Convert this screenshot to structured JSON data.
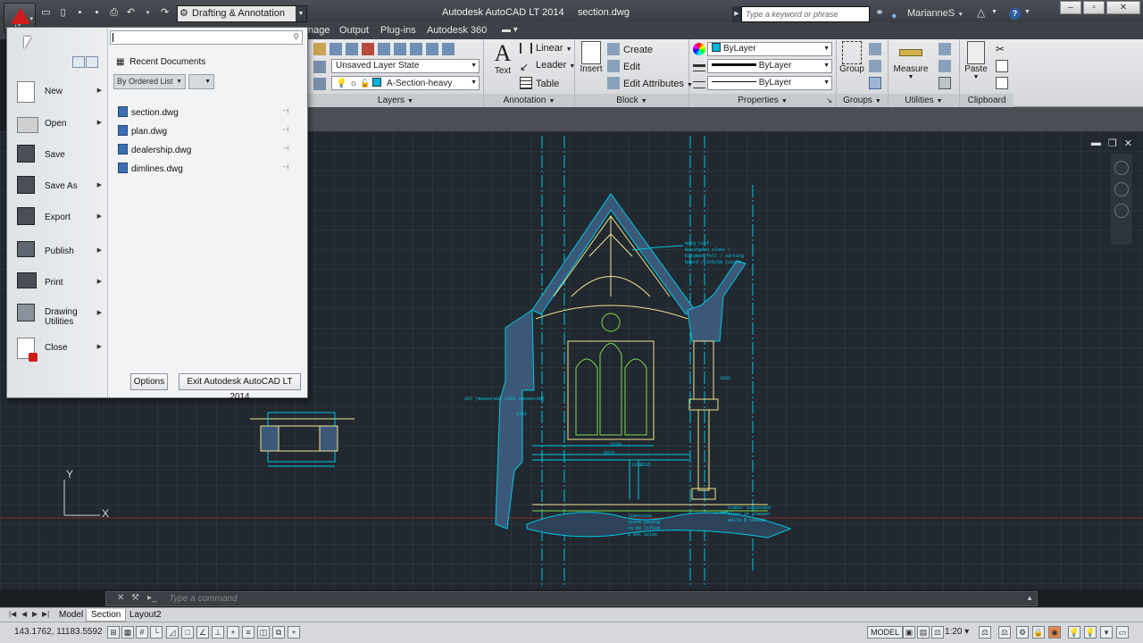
{
  "window": {
    "app_title": "Autodesk AutoCAD LT 2014",
    "file_title": "section.dwg",
    "app_button_label": "LT",
    "workspace": "Drafting & Annotation",
    "search_placeholder": "Type a keyword or phrase",
    "user": "MarianneS",
    "help": "?"
  },
  "ribbon": {
    "tabs": [
      "nage",
      "Output",
      "Plug-ins",
      "Autodesk 360"
    ],
    "panels": {
      "layers": {
        "label": "Layers",
        "layer_state": "Unsaved Layer State",
        "current_layer": "A-Section-heavy"
      },
      "annotation": {
        "label": "Annotation",
        "text_label": "Text",
        "linear_label": "Linear",
        "leader_label": "Leader",
        "table_label": "Table"
      },
      "block": {
        "label": "Block",
        "insert_label": "Insert",
        "create_label": "Create",
        "edit_label": "Edit",
        "edit_attributes_label": "Edit Attributes"
      },
      "properties": {
        "label": "Properties",
        "color": "ByLayer",
        "lineweight": "ByLayer",
        "linetype": "ByLayer"
      },
      "groups": {
        "label": "Groups",
        "group_label": "Group"
      },
      "utilities": {
        "label": "Utilities",
        "measure_label": "Measure"
      },
      "clipboard": {
        "label": "Clipboard",
        "paste_label": "Paste"
      }
    }
  },
  "app_menu": {
    "search_value": "",
    "recent_header": "Recent Documents",
    "order_by": "By Ordered List",
    "items": [
      {
        "label": "New",
        "icon": "new-doc-icon",
        "has_submenu": true
      },
      {
        "label": "Open",
        "icon": "open-folder-icon",
        "has_submenu": true
      },
      {
        "label": "Save",
        "icon": "save-disk-icon",
        "has_submenu": false
      },
      {
        "label": "Save As",
        "icon": "save-as-icon",
        "has_submenu": true
      },
      {
        "label": "Export",
        "icon": "export-icon",
        "has_submenu": true
      },
      {
        "label": "Publish",
        "icon": "publish-icon",
        "has_submenu": true
      },
      {
        "label": "Print",
        "icon": "printer-icon",
        "has_submenu": true
      },
      {
        "label": "Drawing Utilities",
        "icon": "wrench-icon",
        "has_submenu": true
      },
      {
        "label": "Close",
        "icon": "close-doc-icon",
        "has_submenu": true
      }
    ],
    "recent_files": [
      "section.dwg",
      "plan.dwg",
      "dealership.dwg",
      "dimlines.dwg"
    ],
    "options_label": "Options",
    "exit_label": "Exit Autodesk AutoCAD LT 2014"
  },
  "drawing": {
    "ucs_x": "X",
    "ucs_y": "Y",
    "dim_labels": [
      "5150",
      "6875",
      "2150",
      "1315",
      "2525",
      "3025"
    ],
    "annotations": [
      "mstg roof:",
      "Bovingdon slate /",
      "bitumen felt / sarking",
      "board / 225x50 joists",
      "297 (measured) 1215 (measured)",
      "timber suspended",
      "floor on sleeper",
      "walls @ 1400mm",
      "limestone",
      "stone paving",
      "to be lifted",
      "& set aside"
    ]
  },
  "command_line": {
    "placeholder": "Type a command"
  },
  "layout_tabs": [
    "Model",
    "Section",
    "Layout2"
  ],
  "status": {
    "coordinates": "143.1762, 11183.5592",
    "space": "MODEL",
    "scale": "1:20"
  },
  "colors": {
    "canvas": "#212830",
    "cyan": "#00c8e0",
    "yellow": "#f0e68c",
    "green": "#7fd84a",
    "accent_red": "#d11b1b",
    "section_fill": "#3b5878"
  }
}
